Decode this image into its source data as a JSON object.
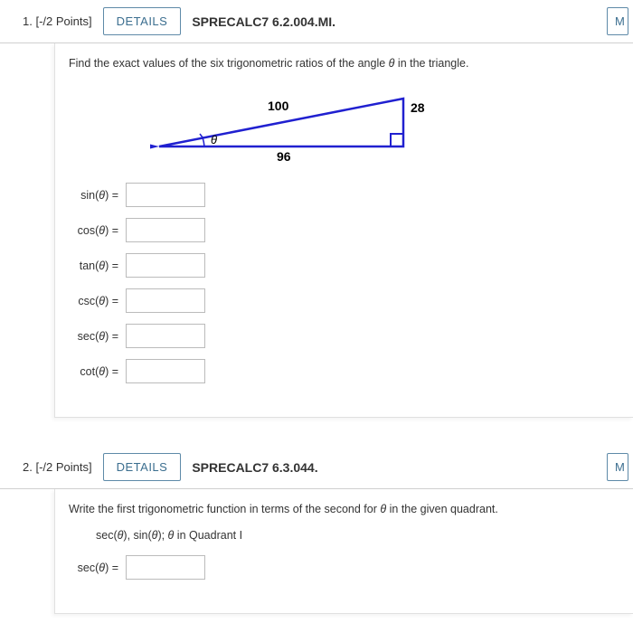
{
  "questions": [
    {
      "number": "1.",
      "points": "[-/2 Points]",
      "details_label": "DETAILS",
      "code": "SPRECALC7 6.2.004.MI.",
      "right_label": "M",
      "prompt_pre": "Find the exact values of the six trigonometric ratios of the angle ",
      "prompt_theta": "θ",
      "prompt_post": " in the triangle.",
      "triangle": {
        "hyp": "100",
        "opp": "28",
        "adj": "96",
        "angle": "θ"
      },
      "ratios": [
        {
          "name": "sin",
          "value": ""
        },
        {
          "name": "cos",
          "value": ""
        },
        {
          "name": "tan",
          "value": ""
        },
        {
          "name": "csc",
          "value": ""
        },
        {
          "name": "sec",
          "value": ""
        },
        {
          "name": "cot",
          "value": ""
        }
      ]
    },
    {
      "number": "2.",
      "points": "[-/2 Points]",
      "details_label": "DETAILS",
      "code": "SPRECALC7 6.3.044.",
      "right_label": "M",
      "prompt_pre": "Write the first trigonometric function in terms of the second for ",
      "prompt_theta": "θ",
      "prompt_post": " in the given quadrant.",
      "sub_a": "sec(",
      "sub_b": "θ",
      "sub_c": "), sin(",
      "sub_d": "θ",
      "sub_e": "); ",
      "sub_f": "θ",
      "sub_g": " in Quadrant I",
      "answer_label_a": "sec(",
      "answer_label_b": "θ",
      "answer_label_c": ") =",
      "answer_value": ""
    }
  ]
}
